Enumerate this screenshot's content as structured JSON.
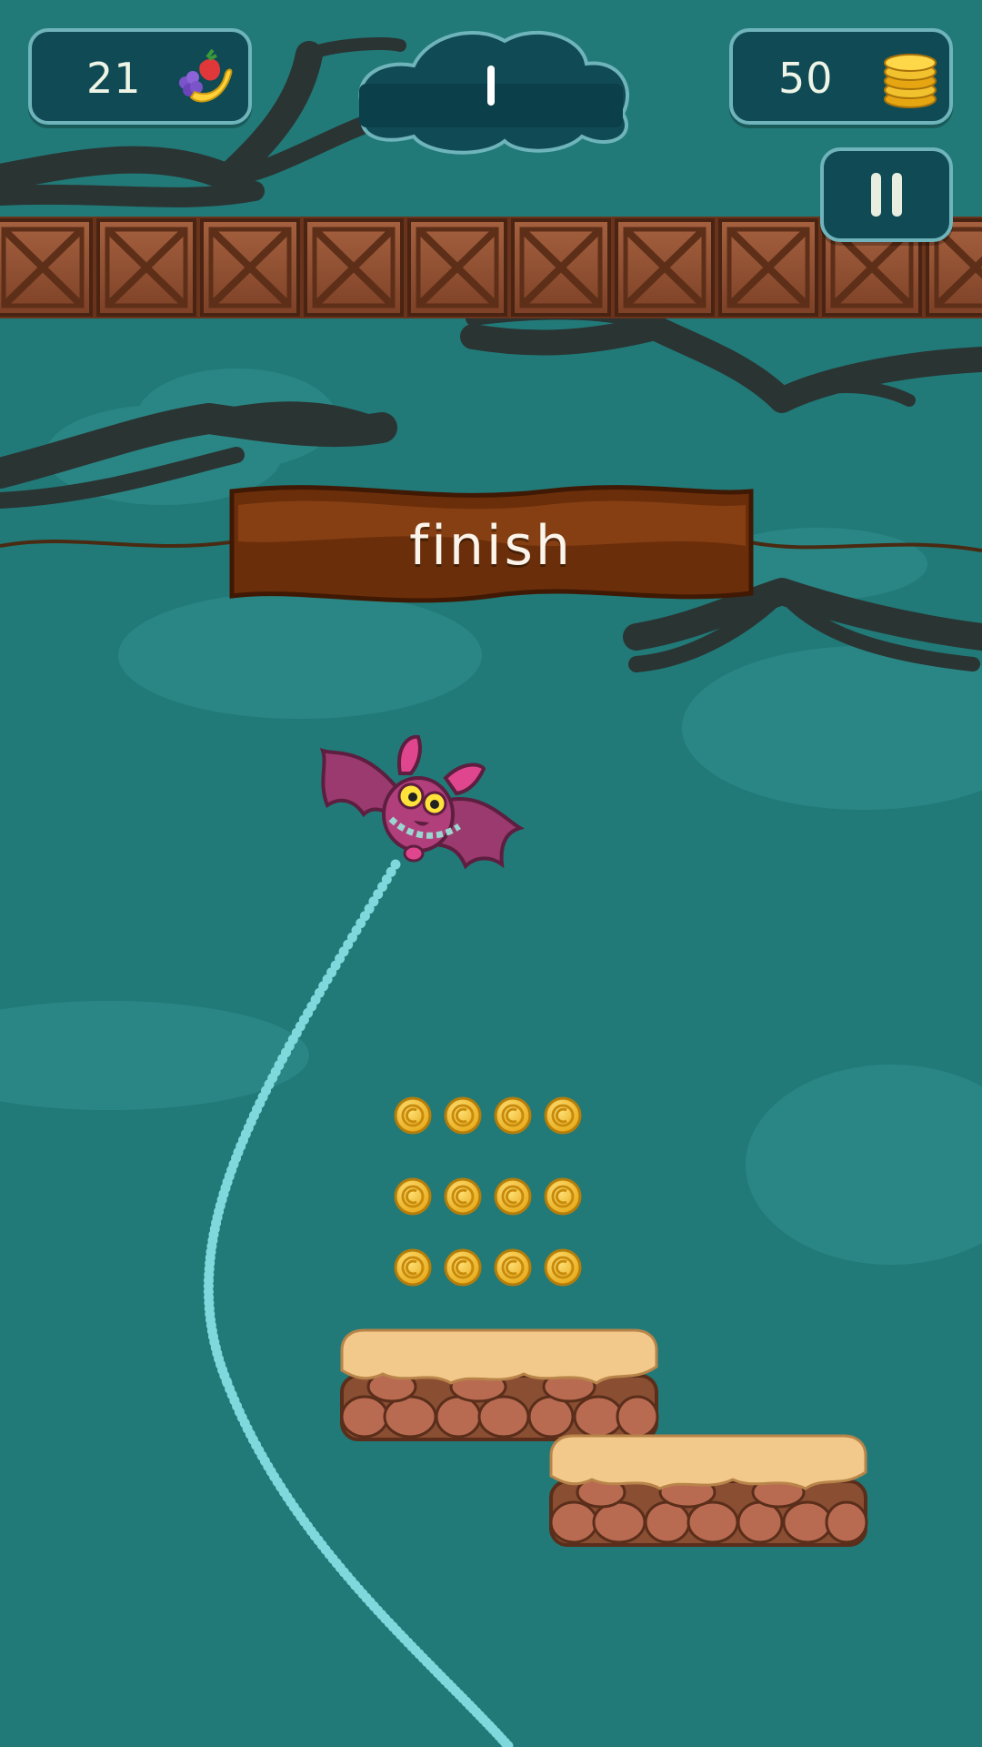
{
  "hud": {
    "fruit_count": "21",
    "coin_count": "50",
    "fruit_icon": "fruit-basket-icon",
    "coin_icon": "coin-stack-icon",
    "pause_icon": "pause-icon",
    "progress_icon": "cloud-progress-meter"
  },
  "level": {
    "finish_label": "finish"
  },
  "colors": {
    "background": "#217a78",
    "hud_panel": "#0f4a55",
    "hud_border": "#6fb4bb",
    "banner": "#6b2e0a",
    "trail": "#7fd8dc",
    "coin": "#f2c12e"
  }
}
